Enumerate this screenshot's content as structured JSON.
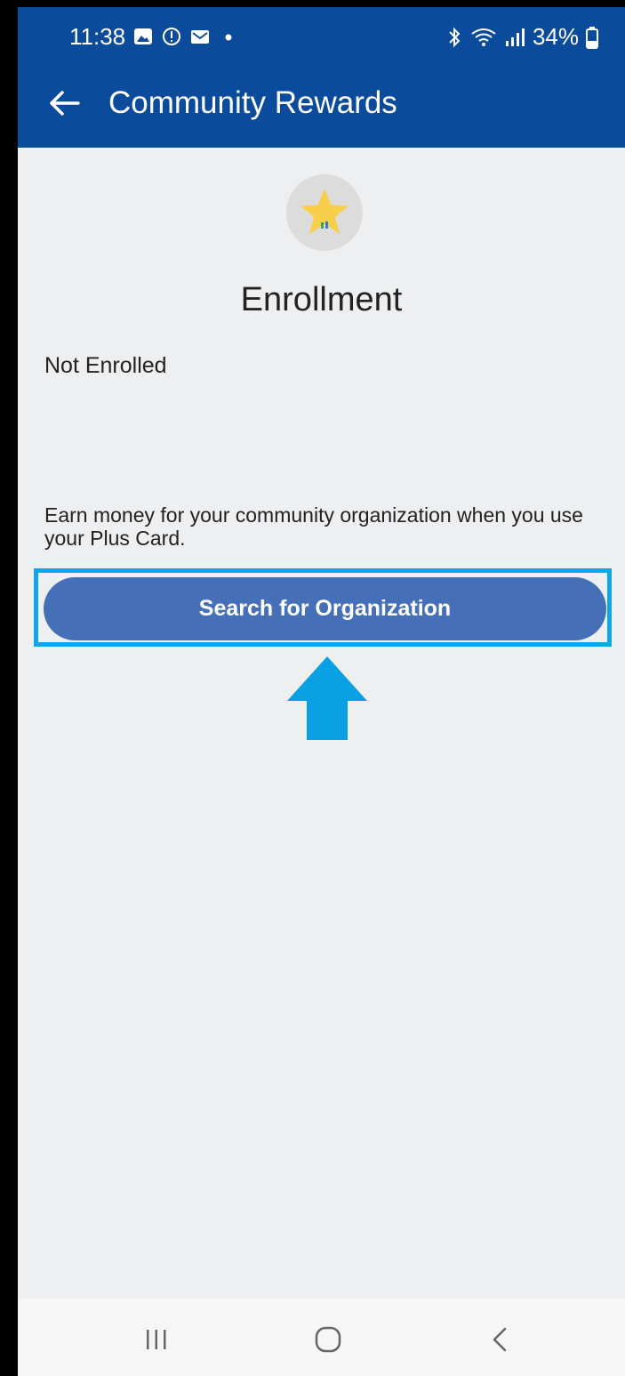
{
  "status_bar": {
    "time": "11:38",
    "battery": "34%"
  },
  "app_bar": {
    "title": "Community Rewards"
  },
  "content": {
    "heading": "Enrollment",
    "status": "Not Enrolled",
    "description": "Earn money for your community organization when you use your Plus Card.",
    "search_button_label": "Search for Organization"
  },
  "colors": {
    "app_bar": "#0b4b9b",
    "button": "#4570b7",
    "highlight": "#0ba7e6",
    "background": "#eeeff1"
  },
  "icons": {
    "status_left": [
      "gallery-icon",
      "shield-alert-icon",
      "mail-icon",
      "dot-icon"
    ],
    "status_right": [
      "bluetooth-icon",
      "wifi-icon",
      "signal-icon",
      "battery-icon"
    ],
    "nav": [
      "recents-icon",
      "home-icon",
      "back-icon"
    ]
  }
}
